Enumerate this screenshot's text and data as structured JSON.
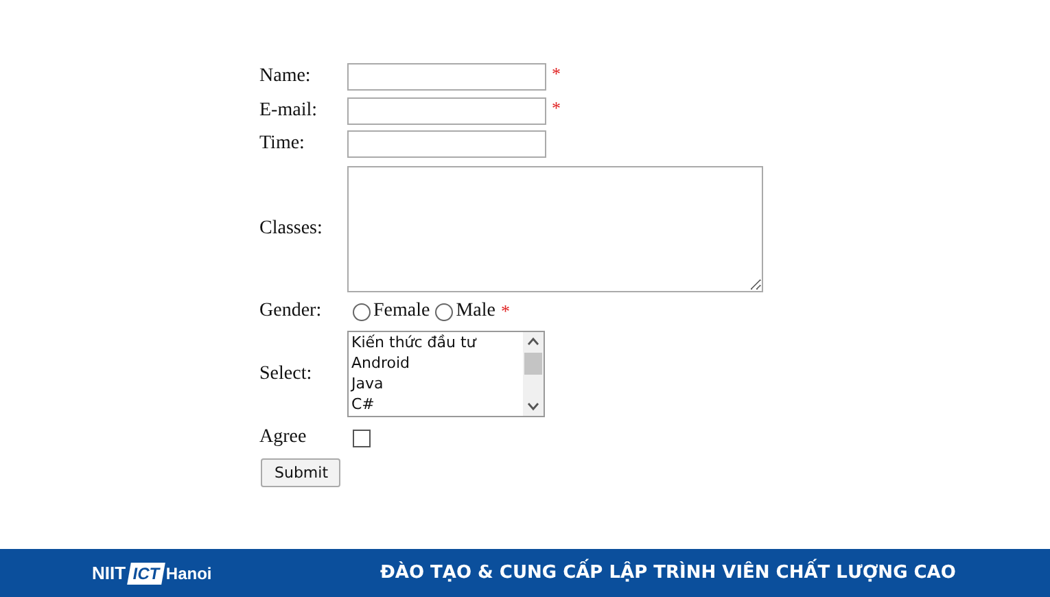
{
  "form": {
    "fields": [
      {
        "kind": "text",
        "label": "Name:",
        "required_mark": "*"
      },
      {
        "kind": "text",
        "label": "E-mail:",
        "required_mark": "*"
      },
      {
        "kind": "text",
        "label": "Time:"
      },
      {
        "kind": "textarea",
        "label": "Classes:"
      },
      {
        "kind": "radio",
        "label": "Gender:",
        "options": [
          {
            "label": "Female",
            "selected": false
          },
          {
            "label": "Male",
            "selected": false
          }
        ],
        "required_mark": "*"
      },
      {
        "kind": "listbox",
        "label": "Select:",
        "options": [
          {
            "label": "Kiến thức đầu tư",
            "selected": false
          },
          {
            "label": "Android",
            "selected": false
          },
          {
            "label": "Java",
            "selected": false
          },
          {
            "label": "C#",
            "selected": false
          }
        ]
      },
      {
        "kind": "checkbox",
        "label": "Agree",
        "checked": false
      }
    ],
    "submit": "Submit"
  },
  "footer": {
    "logo": [
      "NIIT",
      "ICT",
      "Hanoi"
    ],
    "slogan": "ĐÀO TẠO & CUNG CẤP LẬP TRÌNH VIÊN CHẤT LƯỢNG CAO"
  }
}
